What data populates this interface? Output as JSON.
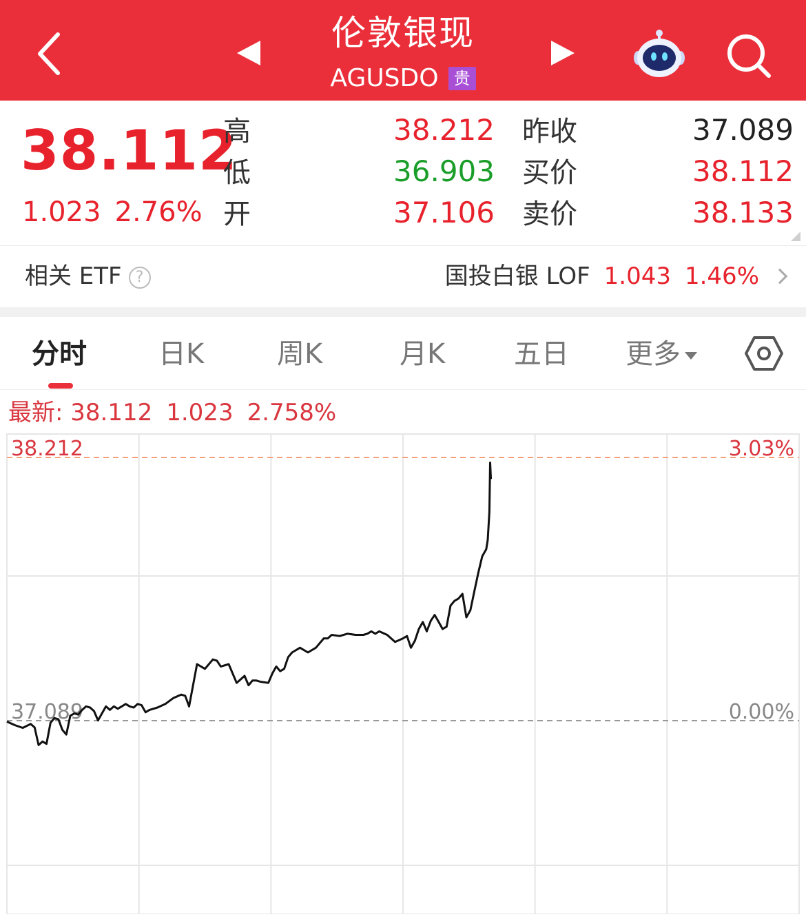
{
  "header": {
    "title": "伦敦银现",
    "code": "AGUSDO",
    "badge": "贵",
    "colors": {
      "background": "#ea2f3a"
    },
    "icons": [
      "back-icon",
      "prev-arrow-icon",
      "next-arrow-icon",
      "robot-assistant-icon",
      "search-icon"
    ]
  },
  "quote": {
    "last": "38.112",
    "change": "1.023",
    "change_pct": "2.76%",
    "labels": {
      "high": "高",
      "low": "低",
      "open": "开",
      "prev_close": "昨收",
      "bid": "买价",
      "ask": "卖价"
    },
    "high": "38.212",
    "low": "36.903",
    "open": "37.106",
    "prev_close": "37.089",
    "bid": "38.112",
    "ask": "38.133",
    "colors": {
      "up": "#e8222c",
      "down": "#1a9e29",
      "neutral": "#222222"
    }
  },
  "etf": {
    "title": "相关 ETF",
    "help": "?",
    "name": "国投白银 LOF",
    "price": "1.043",
    "pct": "1.46%"
  },
  "tabs": [
    "分时",
    "日K",
    "周K",
    "月K",
    "五日",
    "更多"
  ],
  "active_tab": "分时",
  "chart_header": {
    "prefix": "最新: 38.112",
    "change": "1.023",
    "pct": "2.758%"
  },
  "chart_data": {
    "type": "line",
    "title": "",
    "xlabel": "",
    "ylabel": "",
    "ylim": [
      36.75,
      38.45
    ],
    "reference_lines": [
      {
        "value": 38.212,
        "left_label": "38.212",
        "right_label": "3.03%",
        "color": "#f2a07a"
      },
      {
        "value": 37.089,
        "left_label": "37.089",
        "right_label": "0.00%",
        "color": "#999999"
      }
    ],
    "series": [
      {
        "color": "#111111",
        "x_fraction_of_session": [
          0.0,
          0.01,
          0.02,
          0.03,
          0.035,
          0.04,
          0.045,
          0.05,
          0.055,
          0.06,
          0.065,
          0.07,
          0.075,
          0.08,
          0.085,
          0.09,
          0.095,
          0.1,
          0.105,
          0.11,
          0.115,
          0.12,
          0.125,
          0.13,
          0.135,
          0.14,
          0.145,
          0.15,
          0.155,
          0.16,
          0.165,
          0.17,
          0.175,
          0.18,
          0.19,
          0.2,
          0.21,
          0.22,
          0.225,
          0.23,
          0.24,
          0.25,
          0.26,
          0.265,
          0.27,
          0.28,
          0.29,
          0.3,
          0.305,
          0.31,
          0.315,
          0.32,
          0.33,
          0.335,
          0.34,
          0.345,
          0.35,
          0.355,
          0.36,
          0.37,
          0.38,
          0.39,
          0.4,
          0.405,
          0.41,
          0.42,
          0.43,
          0.44,
          0.45,
          0.455,
          0.46,
          0.465,
          0.47,
          0.48,
          0.49,
          0.5,
          0.505,
          0.51,
          0.515,
          0.52,
          0.525,
          0.53,
          0.535,
          0.54,
          0.545,
          0.55,
          0.555,
          0.56,
          0.565,
          0.57,
          0.575,
          0.58,
          0.585,
          0.59,
          0.595,
          0.6,
          0.605,
          0.607,
          0.609,
          0.61,
          0.611
        ],
        "values": [
          37.085,
          37.07,
          37.058,
          37.075,
          37.06,
          36.985,
          37.0,
          36.99,
          37.08,
          37.1,
          37.095,
          37.05,
          37.03,
          37.11,
          37.12,
          37.115,
          37.135,
          37.15,
          37.145,
          37.13,
          37.09,
          37.12,
          37.15,
          37.135,
          37.15,
          37.14,
          37.15,
          37.16,
          37.15,
          37.145,
          37.16,
          37.155,
          37.125,
          37.135,
          37.145,
          37.16,
          37.185,
          37.2,
          37.195,
          37.15,
          37.33,
          37.31,
          37.35,
          37.345,
          37.32,
          37.33,
          37.25,
          37.28,
          37.24,
          37.26,
          37.26,
          37.255,
          37.25,
          37.29,
          37.32,
          37.3,
          37.31,
          37.36,
          37.38,
          37.4,
          37.38,
          37.4,
          37.44,
          37.44,
          37.455,
          37.45,
          37.46,
          37.455,
          37.455,
          37.46,
          37.47,
          37.46,
          37.47,
          37.455,
          37.425,
          37.44,
          37.45,
          37.4,
          37.43,
          37.48,
          37.51,
          37.47,
          37.515,
          37.54,
          37.51,
          37.48,
          37.49,
          37.58,
          37.6,
          37.61,
          37.63,
          37.53,
          37.56,
          37.64,
          37.72,
          37.79,
          37.82,
          37.86,
          37.98,
          38.19,
          38.12
        ]
      }
    ],
    "grid": true,
    "legend": "none"
  }
}
